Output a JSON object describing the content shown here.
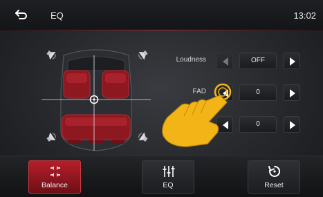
{
  "header": {
    "back_icon": "back-arrow-icon",
    "title": "EQ",
    "time": "13:02"
  },
  "controls": {
    "loudness": {
      "label": "Loudness",
      "value": "OFF"
    },
    "fad": {
      "label": "FAD",
      "value": "0"
    },
    "bal": {
      "label": "",
      "value": "0"
    }
  },
  "tabs": [
    {
      "label": "Balance",
      "icon": "balance-speakers-icon",
      "active": true
    },
    {
      "label": "EQ",
      "icon": "equalizer-sliders-icon",
      "active": false
    },
    {
      "label": "Reset",
      "icon": "reset-icon",
      "active": false
    }
  ],
  "colors": {
    "accent": "#c0262e",
    "seat": "#8e1820",
    "hand": "#f2b416"
  }
}
